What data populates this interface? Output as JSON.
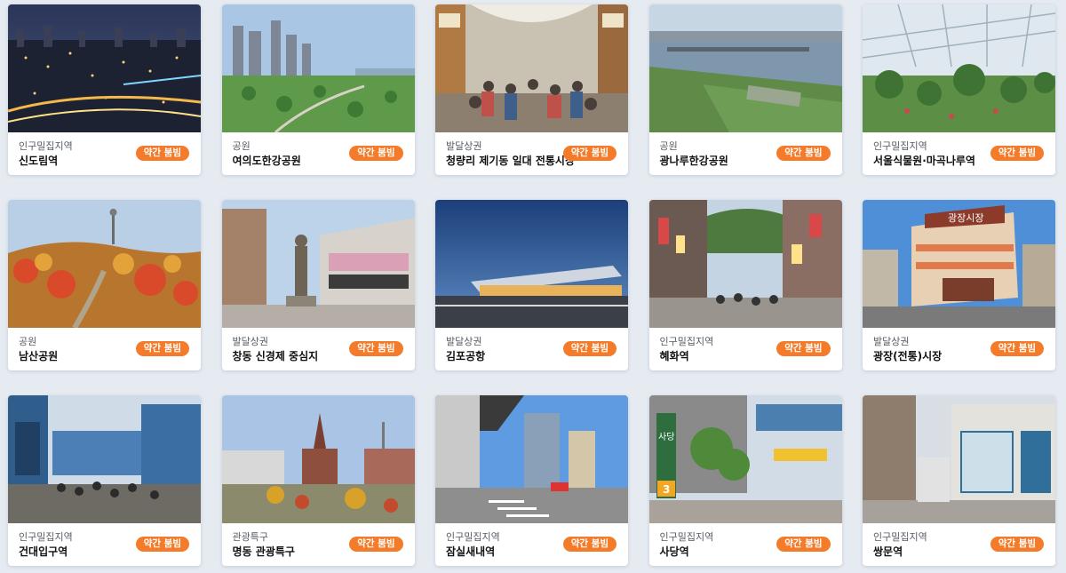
{
  "places": [
    {
      "category": "인구밀집지역",
      "name": "신도림역",
      "status": "약간 붐빔"
    },
    {
      "category": "공원",
      "name": "여의도한강공원",
      "status": "약간 붐빔"
    },
    {
      "category": "발달상권",
      "name": "청량리 제기동 일대 전통시장",
      "status": "약간 붐빔"
    },
    {
      "category": "공원",
      "name": "광나루한강공원",
      "status": "약간 붐빔"
    },
    {
      "category": "인구밀집지역",
      "name": "서울식물원·마곡나루역",
      "status": "약간 붐빔"
    },
    {
      "category": "공원",
      "name": "남산공원",
      "status": "약간 붐빔"
    },
    {
      "category": "발달상권",
      "name": "창동 신경제 중심지",
      "status": "약간 붐빔"
    },
    {
      "category": "발달상권",
      "name": "김포공항",
      "status": "약간 붐빔"
    },
    {
      "category": "인구밀집지역",
      "name": "혜화역",
      "status": "약간 붐빔"
    },
    {
      "category": "발달상권",
      "name": "광장(전통)시장",
      "status": "약간 붐빔"
    },
    {
      "category": "인구밀집지역",
      "name": "건대입구역",
      "status": "약간 붐빔"
    },
    {
      "category": "관광특구",
      "name": "명동 관광특구",
      "status": "약간 붐빔"
    },
    {
      "category": "인구밀집지역",
      "name": "잠실새내역",
      "status": "약간 붐빔"
    },
    {
      "category": "인구밀집지역",
      "name": "사당역",
      "status": "약간 붐빔"
    },
    {
      "category": "인구밀집지역",
      "name": "쌍문역",
      "status": "약간 붐빔"
    }
  ],
  "sign_text": {
    "market_sign": "광장시장",
    "station_sign": "사당",
    "station_number": "3"
  },
  "colors": {
    "page_background": "#e6ebf2",
    "badge": "#f47b2a",
    "card": "#ffffff"
  }
}
